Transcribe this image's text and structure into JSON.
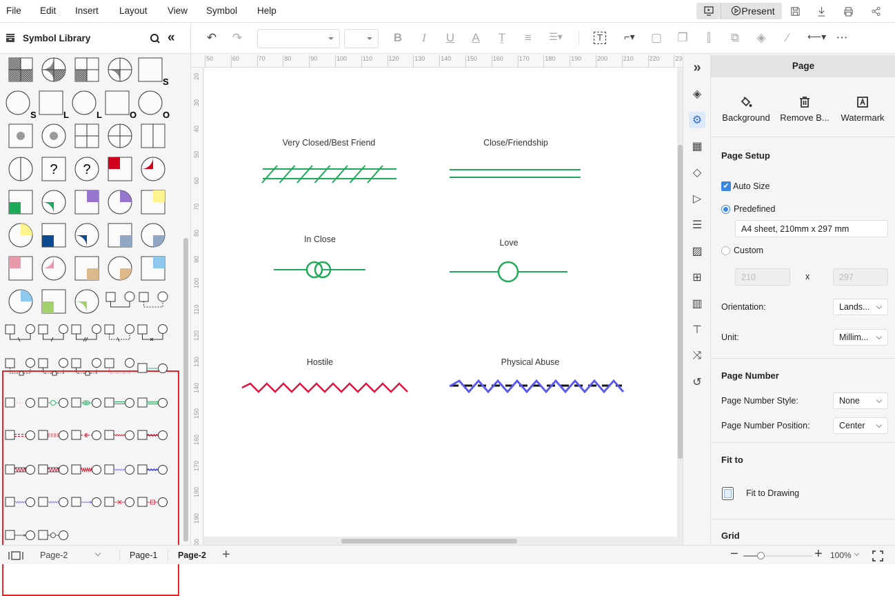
{
  "menu": [
    "File",
    "Edit",
    "Insert",
    "Layout",
    "View",
    "Symbol",
    "Help"
  ],
  "top_actions": {
    "present_label": "Present",
    "icons": [
      "presentation-screen-icon",
      "save-icon",
      "download-icon",
      "print-icon",
      "share-icon"
    ]
  },
  "library": {
    "title": "Symbol Library"
  },
  "toolbar": {
    "font_family": "",
    "font_size": ""
  },
  "symbols": [
    {
      "s": "sq",
      "hatch": "tl,bl,br"
    },
    {
      "s": "ci",
      "hatch": "tl,bl,br"
    },
    {
      "s": "sq",
      "hatch": "bl",
      "grid": true
    },
    {
      "s": "ci",
      "hatch": "bl",
      "grid": true
    },
    {
      "s": "sq",
      "letter": "S"
    },
    {
      "s": "ci",
      "letter": "S"
    },
    {
      "s": "sq",
      "letter": "L"
    },
    {
      "s": "ci",
      "letter": "L"
    },
    {
      "s": "sq",
      "letter": "O"
    },
    {
      "s": "ci",
      "letter": "O"
    },
    {
      "s": "sq",
      "dot": true
    },
    {
      "s": "ci",
      "dot": true
    },
    {
      "s": "sq",
      "grid": true
    },
    {
      "s": "ci",
      "grid": true
    },
    {
      "s": "sq",
      "vsplit": true
    },
    {
      "s": "ci",
      "vsplit": true
    },
    {
      "s": "sq",
      "letter": "?"
    },
    {
      "s": "ci",
      "letter": "?"
    },
    {
      "s": "sq",
      "quad": "tl",
      "color": "#d0021b"
    },
    {
      "s": "ci",
      "quad": "tl",
      "color": "#d0021b"
    },
    {
      "s": "sq",
      "quad": "bl",
      "color": "#1faa59"
    },
    {
      "s": "ci",
      "quad": "bl",
      "color": "#1faa59"
    },
    {
      "s": "sq",
      "quad": "tr",
      "color": "#9575cd"
    },
    {
      "s": "ci",
      "quad": "tr",
      "color": "#9575cd"
    },
    {
      "s": "sq",
      "quad": "tr",
      "color": "#fff48f"
    },
    {
      "s": "ci",
      "quad": "tr",
      "color": "#fff48f"
    },
    {
      "s": "sq",
      "quad": "bl",
      "color": "#0d4a8f"
    },
    {
      "s": "ci",
      "quad": "bl",
      "color": "#0d4a8f"
    },
    {
      "s": "sq",
      "quad": "br",
      "color": "#92a6c6"
    },
    {
      "s": "ci",
      "quad": "br",
      "color": "#92a6c6"
    },
    {
      "s": "sq",
      "quad": "tl",
      "color": "#e89aad"
    },
    {
      "s": "ci",
      "quad": "tl",
      "color": "#e89aad"
    },
    {
      "s": "sq",
      "quad": "br",
      "color": "#ddb98a"
    },
    {
      "s": "ci",
      "quad": "br",
      "color": "#ddb98a"
    },
    {
      "s": "sq",
      "quad": "tr",
      "color": "#8ec8ee"
    },
    {
      "s": "ci",
      "quad": "tr",
      "color": "#8ec8ee"
    },
    {
      "s": "sq",
      "quad": "bl",
      "color": "#a3d16b"
    },
    {
      "s": "ci",
      "quad": "bl",
      "color": "#a3d16b"
    },
    {
      "s": "couple",
      "line": "solid"
    },
    {
      "s": "couple",
      "line": "dashed"
    }
  ],
  "relations": [
    {
      "k": "bracket",
      "line": "solid",
      "mark": "backslash",
      "color": "#333"
    },
    {
      "k": "bracket",
      "line": "solid",
      "mark": "slash",
      "color": "#333"
    },
    {
      "k": "bracket",
      "line": "solid",
      "mark": "double-slash",
      "color": "#333"
    },
    {
      "k": "bracket",
      "line": "dotted",
      "mark": "backslash",
      "color": "#333"
    },
    {
      "k": "bracket",
      "line": "solid",
      "mark": "x",
      "color": "#333"
    },
    {
      "k": "bracket",
      "line": "dotted",
      "mark": "house",
      "color": "#333"
    },
    {
      "k": "bracket",
      "line": "dashdot",
      "mark": "house",
      "color": "#333"
    },
    {
      "k": "bracket",
      "line": "dashdot",
      "mark": "house",
      "color": "#333"
    },
    {
      "k": "bracket",
      "line": "dashdot",
      "mark": "none",
      "color": "#f08090"
    },
    {
      "k": "straight",
      "line": "solid",
      "color": "#3cb371"
    },
    {
      "k": "straight",
      "line": "dotted",
      "color": "#f08090"
    },
    {
      "k": "straight",
      "line": "circle",
      "color": "#3cb371"
    },
    {
      "k": "straight",
      "line": "double-circle",
      "color": "#3cb371"
    },
    {
      "k": "straight",
      "line": "double",
      "color": "#1a9e50"
    },
    {
      "k": "straight",
      "line": "hatched",
      "color": "#1a9e50"
    },
    {
      "k": "straight",
      "line": "double-dash",
      "color": "#d0021b"
    },
    {
      "k": "straight",
      "line": "triple-dash",
      "color": "#d0021b"
    },
    {
      "k": "straight",
      "line": "bars",
      "color": "#d0021b"
    },
    {
      "k": "straight",
      "line": "wave",
      "color": "#d0021b"
    },
    {
      "k": "straight",
      "line": "wave-black",
      "color": "#d0021b"
    },
    {
      "k": "straight",
      "line": "zigzag-box",
      "color": "#d0021b"
    },
    {
      "k": "straight",
      "line": "zigzag-box",
      "color": "#d0021b"
    },
    {
      "k": "straight",
      "line": "zigzag",
      "color": "#d0021b"
    },
    {
      "k": "straight",
      "line": "wave",
      "color": "#6b6bff"
    },
    {
      "k": "straight",
      "line": "wave-black",
      "color": "#3b3bff"
    },
    {
      "k": "straight",
      "line": "wave",
      "color": "#6b6bff"
    },
    {
      "k": "straight",
      "line": "wave",
      "color": "#6b6bff"
    },
    {
      "k": "straight",
      "line": "arrow",
      "color": "#6b6bff"
    },
    {
      "k": "straight",
      "line": "x",
      "color": "#e0405a"
    },
    {
      "k": "straight",
      "line": "box",
      "color": "#e0405a"
    },
    {
      "k": "straight",
      "line": "arrow",
      "color": "#555"
    },
    {
      "k": "straight",
      "line": "circle",
      "color": "#555"
    }
  ],
  "ruler": {
    "top": [
      50,
      60,
      70,
      80,
      90,
      100,
      110,
      120,
      130,
      140,
      150,
      160,
      170,
      180,
      190,
      200,
      210,
      220,
      230
    ],
    "left": [
      20,
      30,
      40,
      50,
      60,
      70,
      80,
      90,
      100,
      110,
      120,
      130,
      140,
      150,
      160,
      170,
      180,
      190,
      200
    ]
  },
  "canvas": {
    "shapes": [
      {
        "label": "Very Closed/Best Friend",
        "style": "double-hatched",
        "color": "#1faa59"
      },
      {
        "label": "Close/Friendship",
        "style": "double",
        "color": "#1faa59"
      },
      {
        "label": "In Close",
        "style": "double-ring",
        "color": "#1faa59"
      },
      {
        "label": "Love",
        "style": "ring",
        "color": "#1faa59"
      },
      {
        "label": "Hostile",
        "style": "zigzag",
        "color": "#e0143c"
      },
      {
        "label": "Physical Abuse",
        "style": "zigzag-dashed",
        "color": "#5a5af0"
      }
    ]
  },
  "right_strip": [
    "expand-panel-icon",
    "fill-icon",
    "page-settings-icon",
    "grid-apps-icon",
    "layers-icon",
    "slideshow-icon",
    "database-icon",
    "image-icon",
    "org-chart-icon",
    "building-icon",
    "flow-icon",
    "shuffle-icon",
    "history-icon"
  ],
  "panel": {
    "title": "Page",
    "actions": [
      "Background",
      "Remove B...",
      "Watermark"
    ],
    "page_setup": {
      "heading": "Page Setup",
      "auto_size": "Auto Size",
      "auto_size_checked": true,
      "predefined": "Predefined",
      "predefined_selected": true,
      "predefined_value": "A4 sheet, 210mm x 297 mm",
      "custom": "Custom",
      "width": "210",
      "height": "297",
      "x": "x",
      "orientation_label": "Orientation:",
      "orientation": "Lands...",
      "unit_label": "Unit:",
      "unit": "Millim..."
    },
    "page_number": {
      "heading": "Page Number",
      "style_label": "Page Number Style:",
      "style": "None",
      "position_label": "Page Number Position:",
      "position": "Center"
    },
    "fit": {
      "heading": "Fit to",
      "fit_drawing": "Fit to Drawing"
    },
    "grid": {
      "heading": "Grid"
    }
  },
  "status": {
    "current_page": "Page-2",
    "tabs": [
      "Page-1",
      "Page-2"
    ],
    "active_tab": "Page-2",
    "zoom": "100%",
    "zoom_fraction": 0.25
  }
}
